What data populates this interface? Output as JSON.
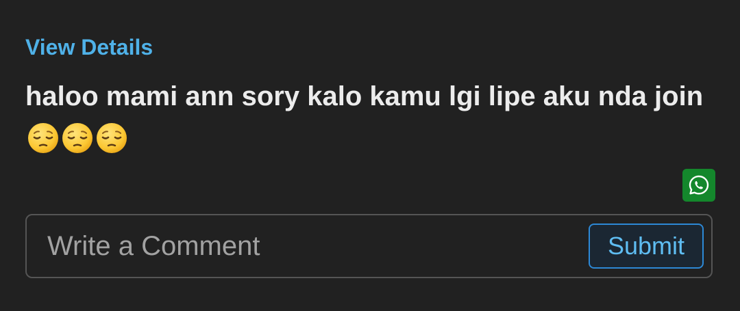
{
  "post": {
    "view_details_label": "View Details",
    "message_text": "haloo mami ann sory kalo kamu lgi lipe aku nda join",
    "emojis": [
      "pensive-face",
      "pensive-face",
      "pensive-face"
    ]
  },
  "share": {
    "icon": "whatsapp-icon",
    "color": "#14872c"
  },
  "comment": {
    "placeholder": "Write a Comment",
    "value": "",
    "submit_label": "Submit"
  },
  "colors": {
    "background": "#212121",
    "link": "#4fb1e8",
    "text": "#ececec",
    "placeholder": "#a2a2a2",
    "submit_border": "#2d89d6",
    "submit_text": "#5fbdf2"
  }
}
